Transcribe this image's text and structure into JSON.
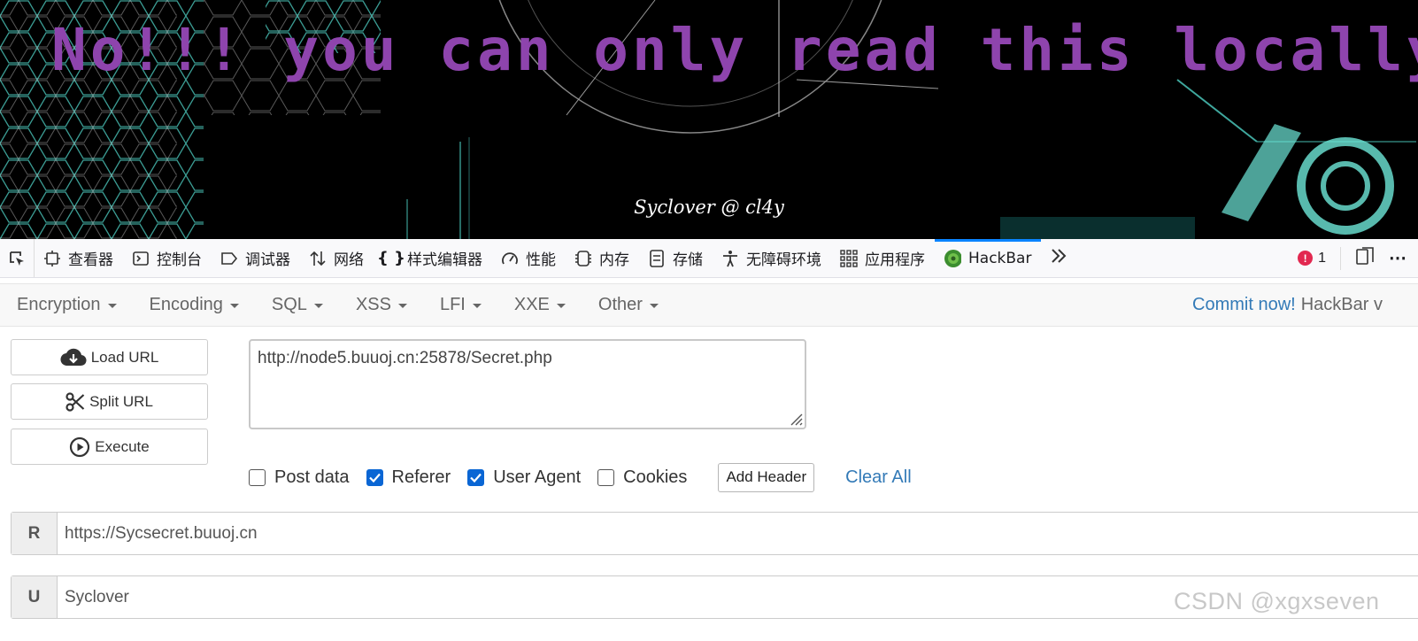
{
  "banner": {
    "headline": "No!!! you can only read this locally!!!",
    "signature": "Syclover @ cl4y",
    "headline_color": "#8e44ad"
  },
  "devtools": {
    "tabs": [
      {
        "label": "查看器",
        "icon": "inspector-icon"
      },
      {
        "label": "控制台",
        "icon": "console-icon"
      },
      {
        "label": "调试器",
        "icon": "debugger-icon"
      },
      {
        "label": "网络",
        "icon": "network-icon"
      },
      {
        "label": "样式编辑器",
        "icon": "style-editor-icon"
      },
      {
        "label": "性能",
        "icon": "performance-icon"
      },
      {
        "label": "内存",
        "icon": "memory-icon"
      },
      {
        "label": "存储",
        "icon": "storage-icon"
      },
      {
        "label": "无障碍环境",
        "icon": "accessibility-icon"
      },
      {
        "label": "应用程序",
        "icon": "application-icon"
      },
      {
        "label": "HackBar",
        "icon": "hackbar-icon",
        "active": true
      }
    ],
    "error_count": "1",
    "accent": "#0a84ff"
  },
  "hackbar": {
    "menus": [
      "Encryption",
      "Encoding",
      "SQL",
      "XSS",
      "LFI",
      "XXE",
      "Other"
    ],
    "commit_link": "Commit now!",
    "version_text": "HackBar v",
    "buttons": {
      "load_url": "Load URL",
      "split_url": "Split URL",
      "execute": "Execute"
    },
    "url": "http://node5.buuoj.cn:25878/Secret.php",
    "options": {
      "post_data": {
        "label": "Post data",
        "checked": false
      },
      "referer": {
        "label": "Referer",
        "checked": true
      },
      "user_agent": {
        "label": "User Agent",
        "checked": true
      },
      "cookies": {
        "label": "Cookies",
        "checked": false
      }
    },
    "add_header": "Add Header",
    "clear_all": "Clear All",
    "headers": [
      {
        "key": "R",
        "value": "https://Sycsecret.buuoj.cn"
      },
      {
        "key": "U",
        "value": "Syclover"
      }
    ]
  },
  "watermark": "CSDN @xgxseven"
}
